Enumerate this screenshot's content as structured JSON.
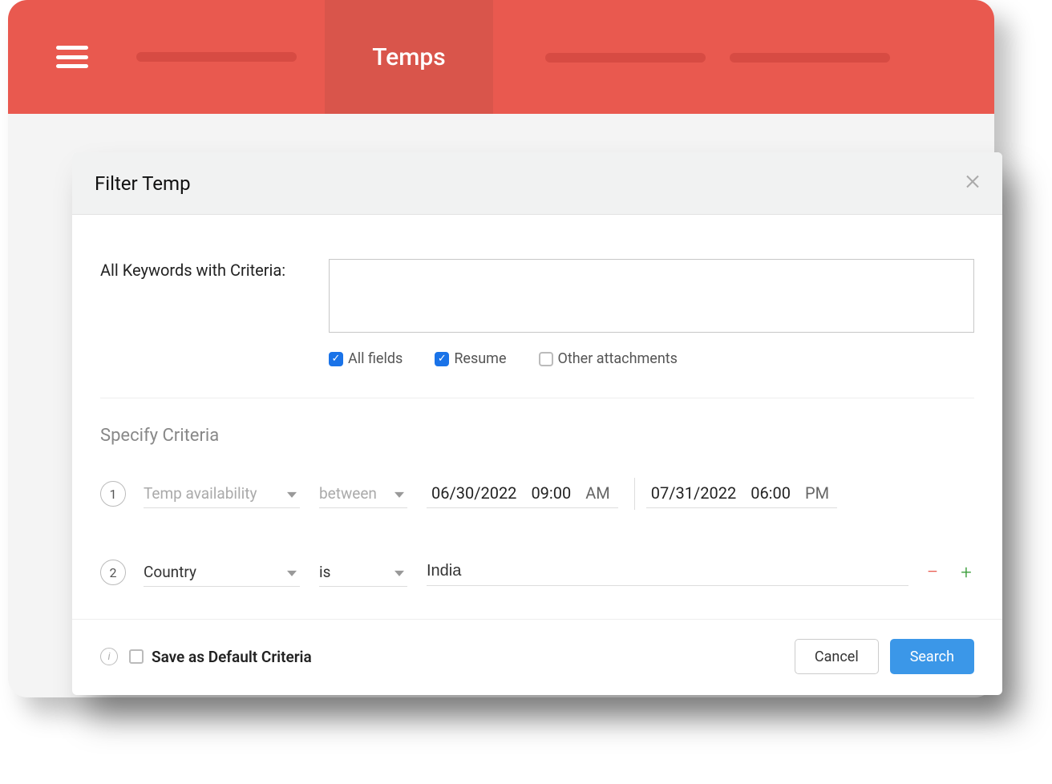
{
  "header": {
    "active_tab": "Temps"
  },
  "modal": {
    "title": "Filter Temp",
    "keywords": {
      "label": "All Keywords with Criteria:",
      "value": "",
      "options": {
        "all_fields": {
          "label": "All fields",
          "checked": true
        },
        "resume": {
          "label": "Resume",
          "checked": true
        },
        "other_attachments": {
          "label": "Other attachments",
          "checked": false
        }
      }
    },
    "specify_title": "Specify Criteria",
    "criteria": [
      {
        "num": "1",
        "field": "Temp availability",
        "operator": "between",
        "from_date": "06/30/2022",
        "from_time": "09:00",
        "from_ampm": "AM",
        "to_date": "07/31/2022",
        "to_time": "06:00",
        "to_ampm": "PM"
      },
      {
        "num": "2",
        "field": "Country",
        "operator": "is",
        "value": "India"
      }
    ],
    "footer": {
      "save_default_label": "Save as Default Criteria",
      "save_default_checked": false,
      "cancel": "Cancel",
      "search": "Search"
    }
  }
}
